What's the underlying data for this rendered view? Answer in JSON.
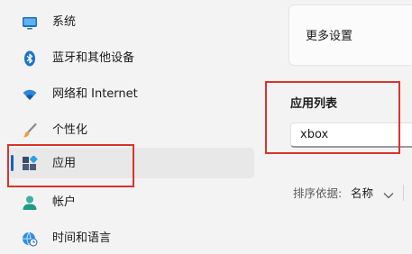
{
  "sidebar": {
    "items": [
      {
        "label": "系统",
        "icon": "system-icon"
      },
      {
        "label": "蓝牙和其他设备",
        "icon": "bluetooth-icon"
      },
      {
        "label": "网络和 Internet",
        "icon": "wifi-icon"
      },
      {
        "label": "个性化",
        "icon": "brush-icon"
      },
      {
        "label": "应用",
        "icon": "apps-icon",
        "selected": true
      },
      {
        "label": "帐户",
        "icon": "account-icon"
      },
      {
        "label": "时间和语言",
        "icon": "globe-clock-icon"
      }
    ]
  },
  "main": {
    "more_settings_label": "更多设置",
    "app_list_title": "应用列表",
    "search_value": "xbox",
    "sort_label": "排序依据:",
    "sort_value": "名称"
  },
  "colors": {
    "accent": "#0067c0",
    "highlight": "#d9342b",
    "selected_bg": "#e8e8e8"
  }
}
